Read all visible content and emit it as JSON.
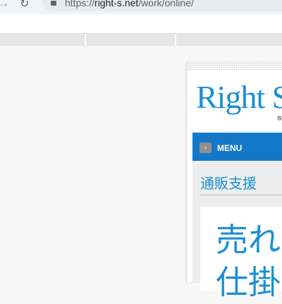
{
  "browser": {
    "url_scheme": "https://",
    "url_host": "right-s.net",
    "url_path": "/work/online/"
  },
  "site": {
    "logo": "Right S",
    "logo_sub": "株",
    "menu_label": "MENU",
    "section_title": "通販支援",
    "heading": "売れ",
    "heading_line2": "仕掛"
  }
}
